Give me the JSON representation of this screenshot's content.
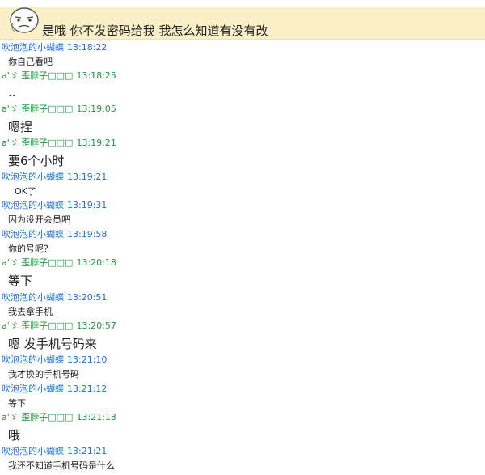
{
  "top_message": {
    "text": "是哦 你不发密码给我 我怎么知道有没有改",
    "avatar_icon": "face-emoticon-icon"
  },
  "users": {
    "a": "吹泡泡的小蝴蝶",
    "b": "a'ゞ 歪脖子□□□"
  },
  "colors": {
    "user_a": "#1a6fd8",
    "user_b": "#1e9a3e",
    "banner_bg": "#fbefc7"
  },
  "messages": [
    {
      "sender": "吹泡泡的小蝴蝶",
      "time": "13:18:22",
      "text": "你自己看吧"
    },
    {
      "sender": "a'ゞ 歪脖子□□□",
      "time": "13:18:25",
      "text": ".."
    },
    {
      "sender": "a'ゞ 歪脖子□□□",
      "time": "13:19:05",
      "text": "嗯捏"
    },
    {
      "sender": "a'ゞ 歪脖子□□□",
      "time": "13:19:21",
      "text": "要6个小时"
    },
    {
      "sender": "吹泡泡的小蝴蝶",
      "time": "13:19:21",
      "text": "OK了"
    },
    {
      "sender": "吹泡泡的小蝴蝶",
      "time": "13:19:31",
      "text": "因为没开会员吧"
    },
    {
      "sender": "吹泡泡的小蝴蝶",
      "time": "13:19:58",
      "text": "你的号呢？"
    },
    {
      "sender": "a'ゞ 歪脖子□□□",
      "time": "13:20:18",
      "text": "等下"
    },
    {
      "sender": "吹泡泡的小蝴蝶",
      "time": "13:20:51",
      "text": "我去拿手机"
    },
    {
      "sender": "a'ゞ 歪脖子□□□",
      "time": "13:20:57",
      "text": "嗯 发手机号码来"
    },
    {
      "sender": "吹泡泡的小蝴蝶",
      "time": "13:21:10",
      "text": "我才换的手机号码"
    },
    {
      "sender": "吹泡泡的小蝴蝶",
      "time": "13:21:12",
      "text": "等下"
    },
    {
      "sender": "a'ゞ 歪脖子□□□",
      "time": "13:21:13",
      "text": "哦"
    },
    {
      "sender": "吹泡泡的小蝴蝶",
      "time": "13:21:21",
      "text": "我还不知道手机号码是什么"
    }
  ]
}
